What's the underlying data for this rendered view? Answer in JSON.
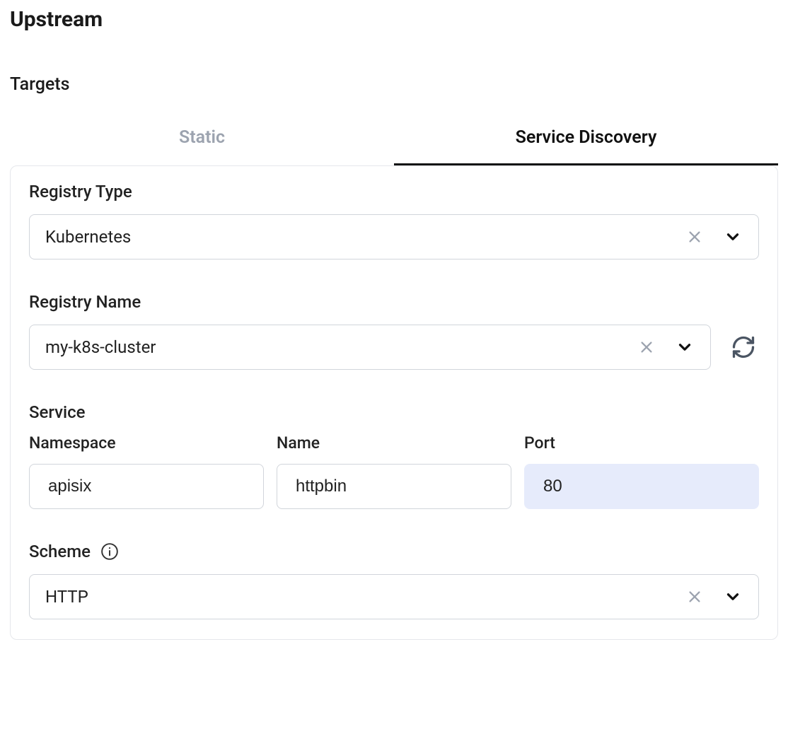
{
  "page": {
    "title": "Upstream"
  },
  "section": {
    "title": "Targets"
  },
  "tabs": {
    "static_label": "Static",
    "service_discovery_label": "Service Discovery"
  },
  "registry_type": {
    "label": "Registry Type",
    "value": "Kubernetes"
  },
  "registry_name": {
    "label": "Registry Name",
    "value": "my-k8s-cluster"
  },
  "service": {
    "heading": "Service",
    "namespace": {
      "label": "Namespace",
      "value": "apisix"
    },
    "name": {
      "label": "Name",
      "value": "httpbin"
    },
    "port": {
      "label": "Port",
      "value": "80"
    }
  },
  "scheme": {
    "label": "Scheme",
    "value": "HTTP"
  }
}
